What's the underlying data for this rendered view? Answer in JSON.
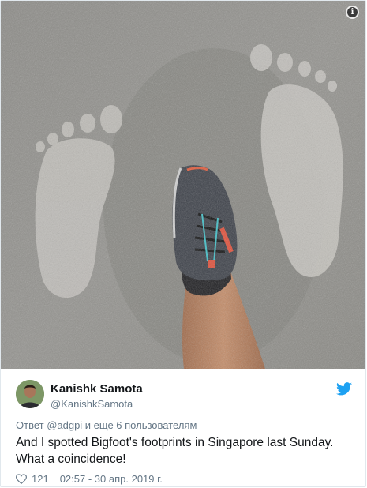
{
  "photo": {
    "subject": "sneaker-on-footprints-photo",
    "info_button": "i"
  },
  "tweet": {
    "author_name": "Kanishk Samota",
    "author_handle": "@KanishkSamota",
    "reply_to": "Ответ @adgpi и еще 6 пользователям",
    "text": "And I spotted Bigfoot's footprints in Singapore last Sunday. What a coincidence!",
    "likes": "121",
    "timestamp": "02:57 - 30 апр. 2019 г.",
    "brand_color": "#1da1f2"
  }
}
